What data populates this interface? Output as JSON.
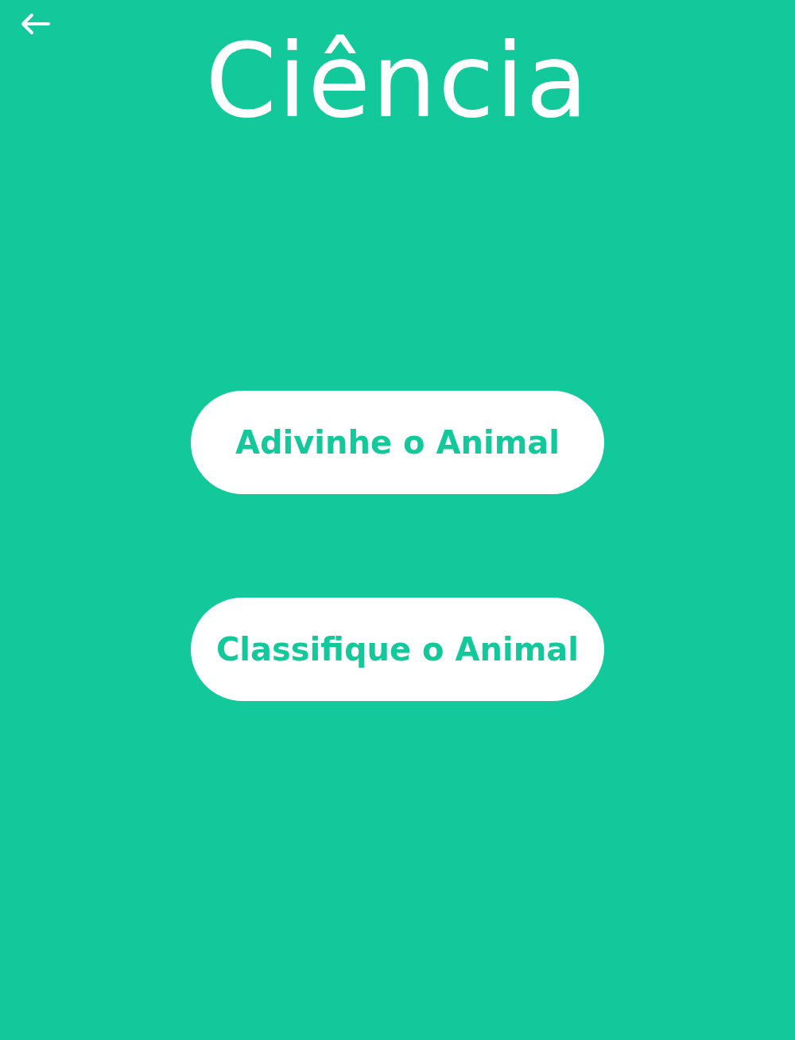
{
  "header": {
    "title": "Ciência"
  },
  "buttons": [
    {
      "label": "Adivinhe o Animal"
    },
    {
      "label": "Classifique o Animal"
    }
  ]
}
